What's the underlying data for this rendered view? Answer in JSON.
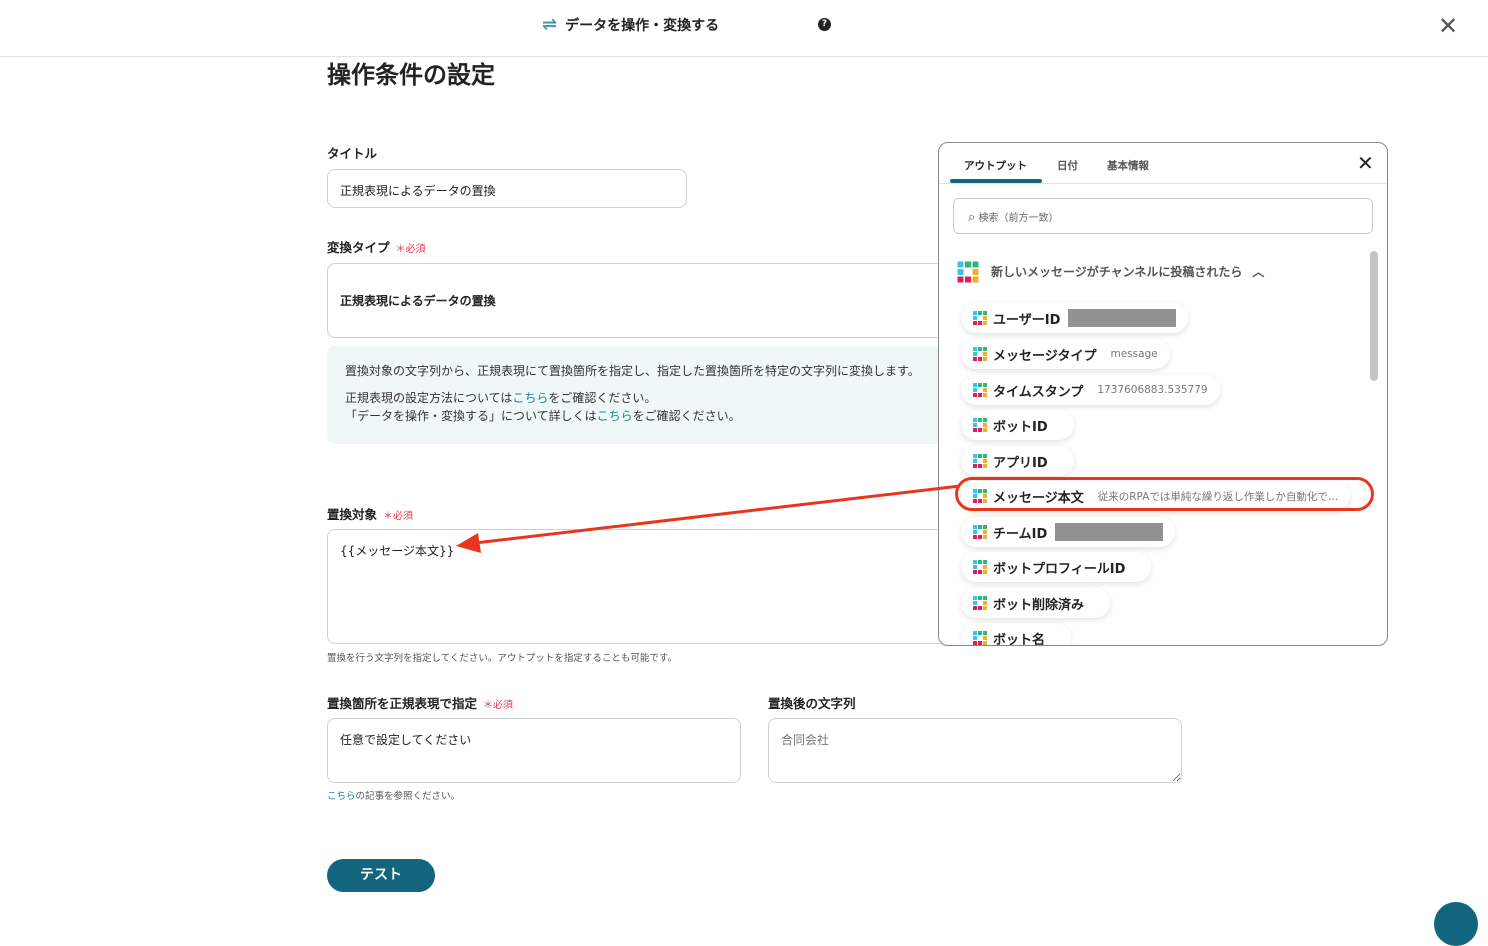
{
  "header": {
    "title": "データを操作・変換する",
    "help_icon": "question-circle-icon",
    "close_icon": "x-icon"
  },
  "page_title": "操作条件の設定",
  "fields": {
    "title_label": "タイトル",
    "title_value": "正規表現によるデータの置換",
    "type_label": "変換タイプ",
    "required": "＊必須",
    "type_value": "正規表現によるデータの置換",
    "info_line1": "置換対象の文字列から、正規表現にて置換箇所を指定し、指定した置換箇所を特定の文字列に変換します。",
    "info_line2_pre": "正規表現の設定方法については",
    "info_link": "こちら",
    "info_line2_post": "をご確認ください。",
    "info_line3_pre": "「データを操作・変換する」について詳しくは",
    "info_line3_post": "をご確認ください。",
    "target_label": "置換対象",
    "target_value": "{{メッセージ本文}}",
    "target_hint": "置換を行う文字列を指定してください。アウトプットを指定することも可能です。",
    "regex_label": "置換箇所を正規表現で指定",
    "regex_value": "任意で設定してください",
    "regex_hint_link": "こちら",
    "regex_hint_post": "の記事を参照ください。",
    "replace_label": "置換後の文字列",
    "replace_placeholder": "合同会社"
  },
  "test_button": "テスト",
  "panel": {
    "tabs": [
      "アウトプット",
      "日付",
      "基本情報"
    ],
    "active_tab": 0,
    "search_placeholder": "検索（前方一致）",
    "group_title": "新しいメッセージがチャンネルに投稿されたら",
    "items": [
      {
        "label": "ユーザーID",
        "value": "",
        "redacted": true
      },
      {
        "label": "メッセージタイプ",
        "value": "message"
      },
      {
        "label": "タイムスタンプ",
        "value": "1737606883.535779"
      },
      {
        "label": "ボットID",
        "value": ""
      },
      {
        "label": "アプリID",
        "value": ""
      },
      {
        "label": "メッセージ本文",
        "value": "従来のRPAでは単純な繰り返し作業しか自動化で…",
        "highlighted": true
      },
      {
        "label": "チームID",
        "value": "",
        "redacted": true
      },
      {
        "label": "ボットプロフィールID",
        "value": ""
      },
      {
        "label": "ボット削除済み",
        "value": ""
      },
      {
        "label": "ボット名",
        "value": ""
      }
    ]
  },
  "colors": {
    "accent": "#13657d",
    "required": "#e8384f",
    "annotation": "#e8361c",
    "link": "#1a7fa0"
  }
}
